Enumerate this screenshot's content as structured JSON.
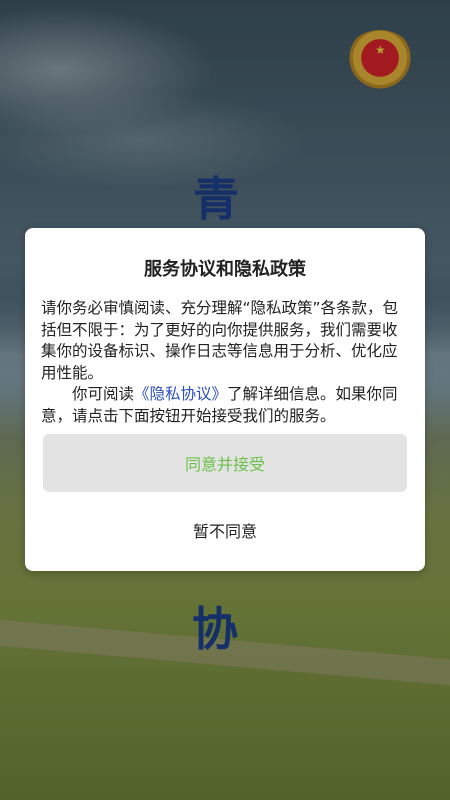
{
  "background": {
    "top_char": "青",
    "bottom_char": "协"
  },
  "dialog": {
    "title": "服务协议和隐私政策",
    "paragraph1": "请你务必审慎阅读、充分理解“隐私政策”各条款，包括但不限于：为了更好的向你提供服务，我们需要收集你的设备标识、操作日志等信息用于分析、优化应用性能。",
    "paragraph2_before_link": "你可阅读",
    "paragraph2_link": "《隐私协议》",
    "paragraph2_after_link": "了解详细信息。如果你同意，请点击下面按钮开始接受我们的服务。",
    "accept_label": "同意并接受",
    "decline_label": "暂不同意"
  },
  "colors": {
    "accept_text": "#6cc04a",
    "link": "#2b4fbf",
    "emblem_red": "#d8232a",
    "emblem_gold": "#e2b33b"
  },
  "icons": {
    "emblem": "cppcc-emblem-icon"
  }
}
